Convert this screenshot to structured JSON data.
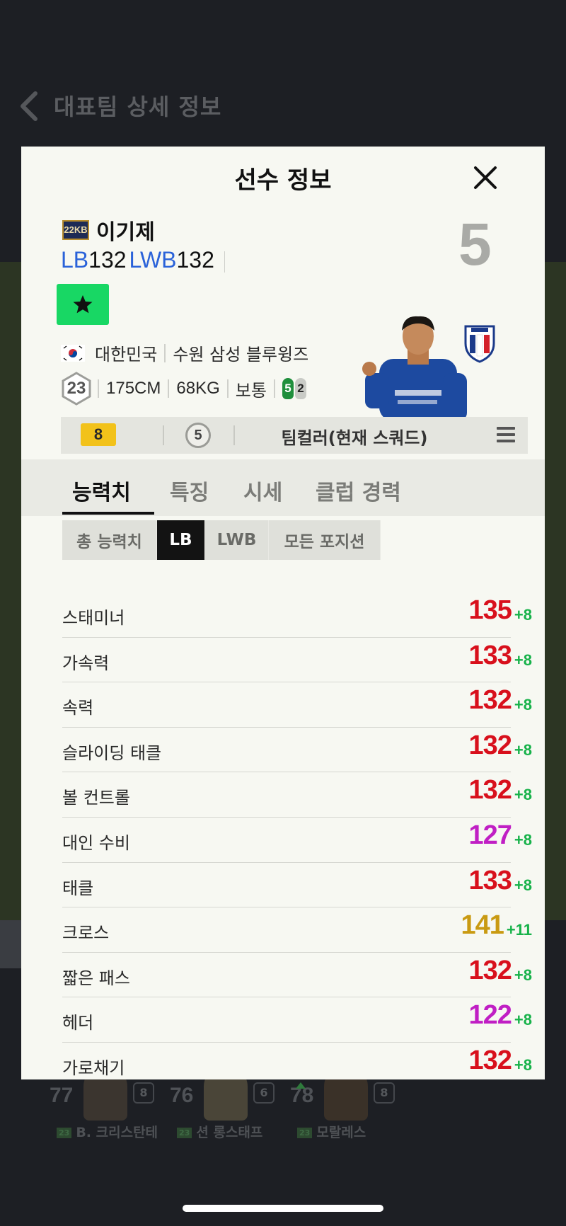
{
  "background": {
    "header_title": "대표팀 상세 정보",
    "players": [
      {
        "ovr": "77",
        "level": "8",
        "season": "23",
        "name": "B. 크리스탄테"
      },
      {
        "ovr": "76",
        "level": "6",
        "season": "23",
        "name": "션 롱스태프"
      },
      {
        "ovr": "78",
        "level": "8",
        "season": "23",
        "name": "모랄레스"
      }
    ]
  },
  "modal": {
    "title": "선수 정보",
    "player": {
      "season_badge": "22KB",
      "name": "이기제",
      "positions": [
        {
          "pos": "LB",
          "ovr": "132"
        },
        {
          "pos": "LWB",
          "ovr": "132"
        }
      ],
      "enhance": "5",
      "nation": "대한민국",
      "club": "수원 삼성 블루윙즈",
      "age": "23",
      "height": "175CM",
      "weight": "68KG",
      "body_type": "보통",
      "left_foot": "5",
      "right_foot": "2"
    },
    "team_bar": {
      "level": "8",
      "grade": "5",
      "team_color": "팀컬러(현재 스쿼드)"
    },
    "tabs": [
      "능력치",
      "특징",
      "시세",
      "클럽 경력"
    ],
    "active_tab": "능력치",
    "subtabs": [
      "총 능력치",
      "LB",
      "LWB",
      "모든 포지션"
    ],
    "active_subtab": "LB",
    "stats": [
      {
        "name": "스태미너",
        "value": "135",
        "bonus": "+8",
        "color": "#d8101c"
      },
      {
        "name": "가속력",
        "value": "133",
        "bonus": "+8",
        "color": "#d8101c"
      },
      {
        "name": "속력",
        "value": "132",
        "bonus": "+8",
        "color": "#d8101c"
      },
      {
        "name": "슬라이딩 태클",
        "value": "132",
        "bonus": "+8",
        "color": "#d8101c"
      },
      {
        "name": "볼 컨트롤",
        "value": "132",
        "bonus": "+8",
        "color": "#d8101c"
      },
      {
        "name": "대인 수비",
        "value": "127",
        "bonus": "+8",
        "color": "#c01fc4"
      },
      {
        "name": "태클",
        "value": "133",
        "bonus": "+8",
        "color": "#d8101c"
      },
      {
        "name": "크로스",
        "value": "141",
        "bonus": "+11",
        "color": "#c99a12"
      },
      {
        "name": "짧은 패스",
        "value": "132",
        "bonus": "+8",
        "color": "#d8101c"
      },
      {
        "name": "헤더",
        "value": "122",
        "bonus": "+8",
        "color": "#c01fc4"
      },
      {
        "name": "가로채기",
        "value": "132",
        "bonus": "+8",
        "color": "#d8101c"
      }
    ]
  }
}
